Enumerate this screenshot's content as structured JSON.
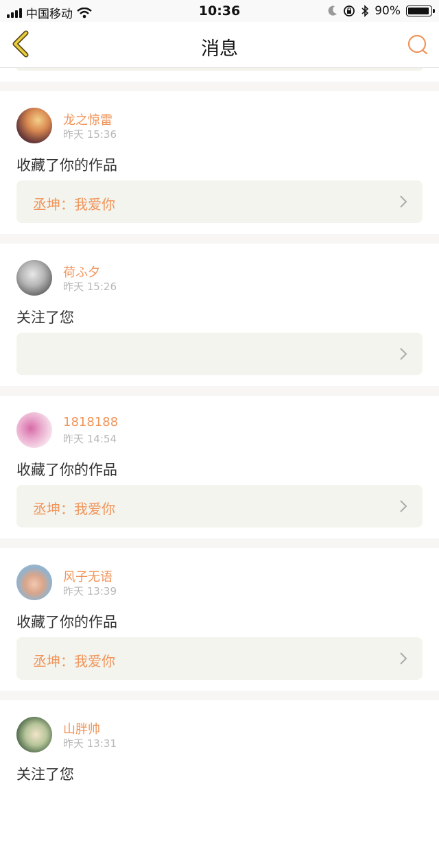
{
  "status_bar": {
    "carrier": "中国移动",
    "time": "10:36",
    "battery": "90%"
  },
  "nav": {
    "title": "消息"
  },
  "messages": [
    {
      "user": "龙之惊雷",
      "time": "昨天 15:36",
      "action": "收藏了你的作品",
      "ref": "丞坤：我爱你"
    },
    {
      "user": "荷ふ夕",
      "time": "昨天 15:26",
      "action": "关注了您",
      "ref": ""
    },
    {
      "user": "1818188",
      "time": "昨天 14:54",
      "action": "收藏了你的作品",
      "ref": "丞坤：我爱你"
    },
    {
      "user": "风子无语",
      "time": "昨天 13:39",
      "action": "收藏了你的作品",
      "ref": "丞坤：我爱你"
    },
    {
      "user": "山胖帅",
      "time": "昨天 13:31",
      "action": "关注了您",
      "ref": ""
    }
  ],
  "colors": {
    "accent": "#f0945a",
    "back_icon": "#c9a92c",
    "ref_box": "#f4f4ee"
  }
}
